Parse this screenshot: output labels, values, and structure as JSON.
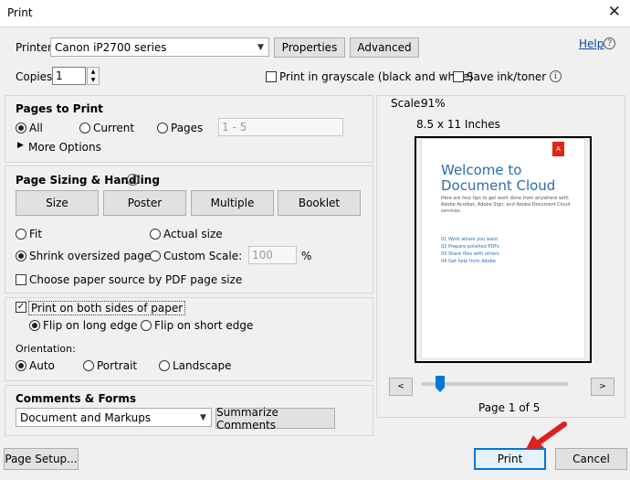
{
  "window": {
    "title": "Print"
  },
  "printer": {
    "label": "Printer:",
    "value": "Canon iP2700 series",
    "properties_label": "Properties",
    "advanced_label": "Advanced",
    "help_label": "Help"
  },
  "copies": {
    "label": "Copies:",
    "value": "1",
    "grayscale_label": "Print in grayscale (black and white)",
    "save_ink_label": "Save ink/toner"
  },
  "pages_to_print": {
    "heading": "Pages to Print",
    "all_label": "All",
    "current_label": "Current",
    "pages_label": "Pages",
    "pages_placeholder": "1 - 5",
    "more_options_label": "More Options"
  },
  "sizing": {
    "heading": "Page Sizing & Handling",
    "size_label": "Size",
    "poster_label": "Poster",
    "multiple_label": "Multiple",
    "booklet_label": "Booklet",
    "fit_label": "Fit",
    "actual_size_label": "Actual size",
    "shrink_label": "Shrink oversized pages",
    "custom_scale_label": "Custom Scale:",
    "custom_scale_value": "100",
    "percent_label": "%",
    "paper_source_label": "Choose paper source by PDF page size"
  },
  "duplex": {
    "both_sides_label": "Print on both sides of paper",
    "long_edge_label": "Flip on long edge",
    "short_edge_label": "Flip on short edge"
  },
  "orientation": {
    "heading": "Orientation:",
    "auto_label": "Auto",
    "portrait_label": "Portrait",
    "landscape_label": "Landscape"
  },
  "comments": {
    "heading": "Comments & Forms",
    "value": "Document and Markups",
    "summarize_label": "Summarize Comments"
  },
  "preview": {
    "scale_label": "Scale:",
    "scale_value": "91%",
    "paper_size": "8.5 x 11 Inches",
    "doc_title": "Welcome to Document Cloud",
    "doc_body": "Here are four tips to get work done from anywhere with Adobe Acrobat, Adobe Sign, and Adobe Document Cloud services.",
    "doc_items": [
      "01  Work where you want",
      "02  Prepare polished PDFs",
      "03  Share files with others",
      "04  Get help from Adobe"
    ],
    "adobe_logo_text": "A",
    "page_indicator": "Page 1 of 5",
    "prev_symbol": "<",
    "next_symbol": ">"
  },
  "footer": {
    "page_setup_label": "Page Setup...",
    "print_label": "Print",
    "cancel_label": "Cancel"
  },
  "colors": {
    "accent": "#0078d7",
    "annotation_arrow": "#e0201b",
    "link": "#0645ad",
    "doc_blue": "#2a6db2"
  }
}
